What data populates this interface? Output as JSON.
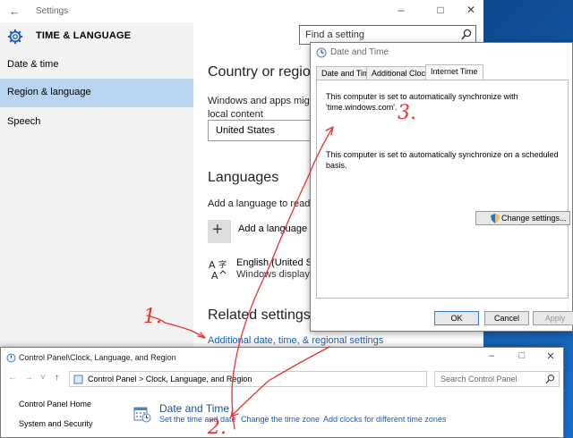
{
  "settings": {
    "window_title": "Settings",
    "header": "TIME & LANGUAGE",
    "search_placeholder": "Find a setting",
    "nav": [
      {
        "label": "Date & time"
      },
      {
        "label": "Region & language"
      },
      {
        "label": "Speech"
      }
    ],
    "main": {
      "country_heading": "Country or regio",
      "country_desc": "Windows and apps might local content",
      "country_value": "United States",
      "languages_heading": "Languages",
      "languages_desc": "Add a language to read a",
      "add_language_label": "Add a language",
      "language_name": "English (United Sta",
      "language_sub": "Windows display la",
      "related_heading": "Related settings",
      "additional_link": "Additional date, time, & regional settings"
    }
  },
  "date_time_dialog": {
    "title": "Date and Time",
    "tabs": [
      {
        "label": "Date and Time"
      },
      {
        "label": "Additional Clocks"
      },
      {
        "label": "Internet Time"
      }
    ],
    "sync_text_1": "This computer is set to automatically synchronize with 'time.windows.com'.",
    "sync_text_2": "This computer is set to automatically synchronize on a scheduled basis.",
    "change_button": "Change settings...",
    "ok_button": "OK",
    "cancel_button": "Cancel",
    "apply_button": "Apply"
  },
  "control_panel": {
    "title": "Control Panel\\Clock, Language, and Region",
    "address": "Control Panel  >  Clock, Language, and Region",
    "search_placeholder": "Search Control Panel",
    "sidebar": [
      {
        "label": "Control Panel Home"
      },
      {
        "label": "System and Security"
      }
    ],
    "section_title": "Date and Time",
    "links": [
      {
        "label": "Set the time and date"
      },
      {
        "label": "Change the time zone"
      },
      {
        "label": "Add clocks for different time zones"
      }
    ]
  },
  "annotations": {
    "step1": "1.",
    "step2": "2.",
    "step3": "3.",
    "color": "#e8322c"
  }
}
